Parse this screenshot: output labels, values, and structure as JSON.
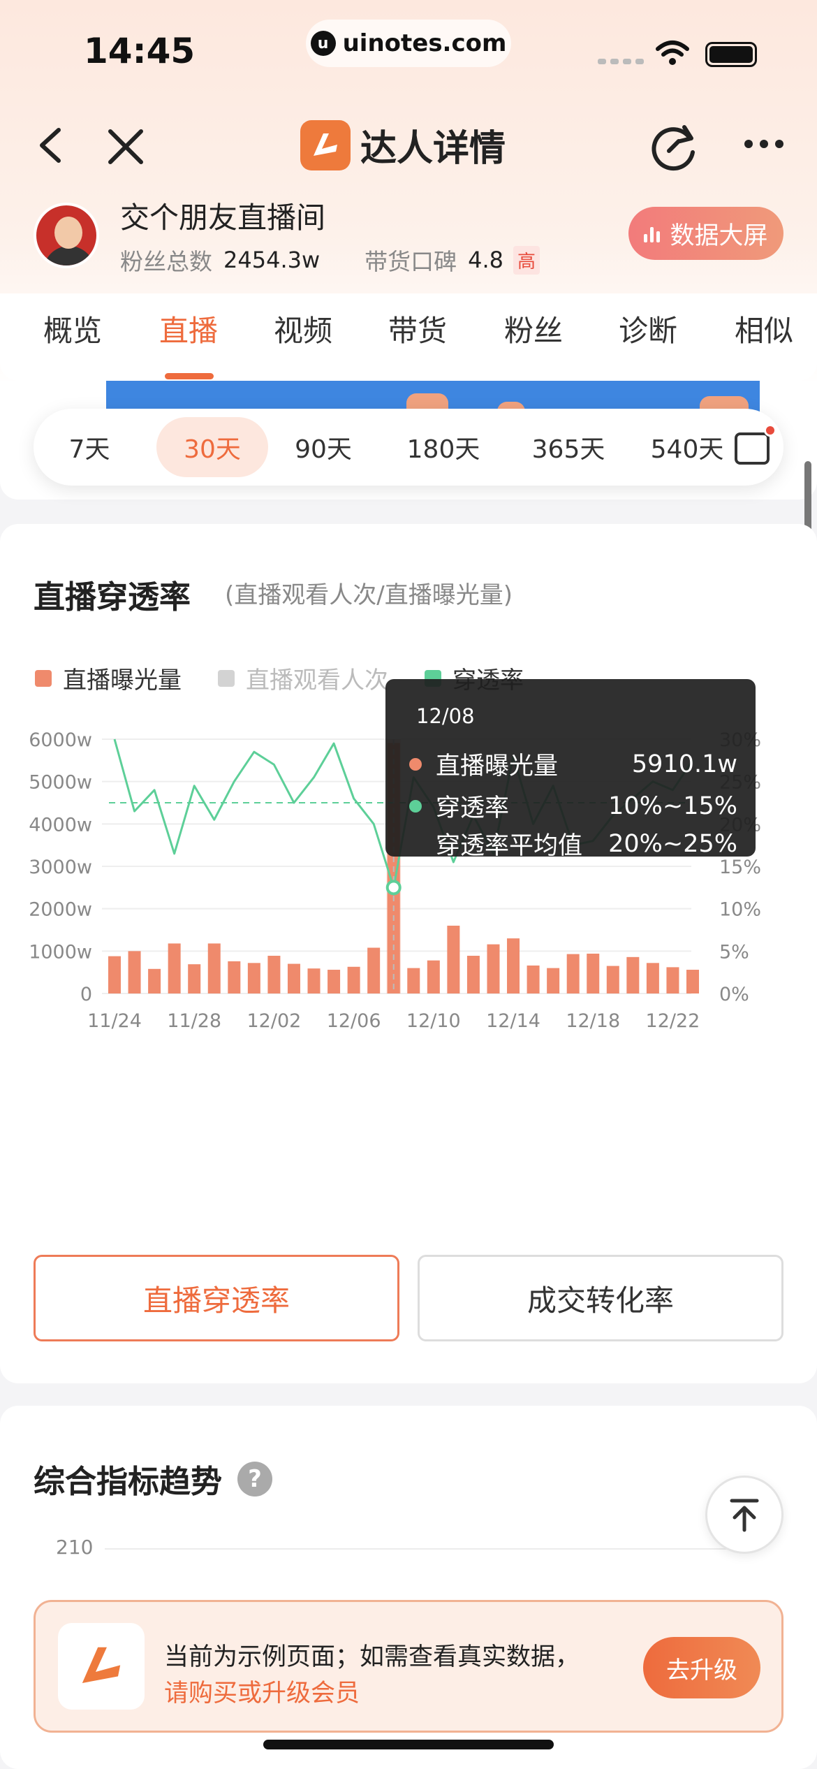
{
  "status_bar": {
    "time": "14:45",
    "url": "uinotes.com"
  },
  "nav": {
    "title": "达人详情"
  },
  "profile": {
    "name": "交个朋友直播间",
    "fans_label": "粉丝总数",
    "fans_value": "2454.3w",
    "reputation_label": "带货口碑",
    "reputation_value": "4.8",
    "reputation_tag": "高",
    "big_screen_label": "数据大屏"
  },
  "tabs": [
    "概览",
    "直播",
    "视频",
    "带货",
    "粉丝",
    "诊断",
    "相似"
  ],
  "active_tab": "直播",
  "day_ranges": [
    "7天",
    "30天",
    "90天",
    "180天",
    "365天",
    "540天"
  ],
  "active_range": "30天",
  "penetration": {
    "title": "直播穿透率",
    "subtitle": "(直播观看人次/直播曝光量)",
    "legend": [
      {
        "name": "直播曝光量",
        "color": "#ef8a6c"
      },
      {
        "name": "直播观看人次",
        "color": "#d3d3d3"
      },
      {
        "name": "穿透率",
        "color": "#5dcf98"
      }
    ],
    "tooltip": {
      "date": "12/08",
      "rows": [
        {
          "label": "直播曝光量",
          "value": "5910.1w"
        },
        {
          "label": "穿透率",
          "value": "10%~15%"
        },
        {
          "label": "穿透率平均值",
          "value": "20%~25%"
        }
      ]
    },
    "buttons": [
      "直播穿透率",
      "成交转化率"
    ]
  },
  "chart_data": {
    "type": "bar",
    "x_ticks": [
      "11/24",
      "11/28",
      "12/02",
      "12/06",
      "12/10",
      "12/14",
      "12/18",
      "12/22"
    ],
    "y_left_ticks": [
      "0",
      "1000w",
      "2000w",
      "3000w",
      "4000w",
      "5000w",
      "6000w"
    ],
    "y_right_ticks": [
      "0%",
      "5%",
      "10%",
      "15%",
      "20%",
      "25%",
      "30%"
    ],
    "ylim_left": [
      0,
      6000
    ],
    "ylim_right": [
      0,
      30
    ],
    "x": [
      "11/24",
      "11/25",
      "11/26",
      "11/27",
      "11/28",
      "11/29",
      "11/30",
      "12/01",
      "12/02",
      "12/03",
      "12/04",
      "12/05",
      "12/06",
      "12/07",
      "12/08",
      "12/09",
      "12/10",
      "12/11",
      "12/12",
      "12/13",
      "12/14",
      "12/15",
      "12/16",
      "12/17",
      "12/18",
      "12/19",
      "12/20",
      "12/21",
      "12/22",
      "12/23"
    ],
    "series": [
      {
        "name": "直播曝光量",
        "axis": "left",
        "values": [
          880,
          1000,
          580,
          1180,
          690,
          1180,
          760,
          720,
          890,
          700,
          590,
          560,
          630,
          1080,
          5910,
          600,
          780,
          1600,
          890,
          1160,
          1300,
          660,
          600,
          930,
          940,
          650,
          860,
          720,
          620,
          560
        ]
      },
      {
        "name": "穿透率",
        "axis": "right",
        "values": [
          30,
          21.5,
          24,
          16.5,
          24.5,
          20.5,
          25,
          28.5,
          27,
          22.5,
          25.5,
          29.5,
          23,
          20,
          12.5,
          25.5,
          22,
          15.5,
          21,
          16.5,
          28,
          20,
          24.5,
          17.5,
          18,
          21,
          23,
          25,
          24,
          27.5
        ]
      },
      {
        "name": "穿透率平均值",
        "axis": "right",
        "style": "dashed",
        "values": [
          22.5
        ]
      }
    ],
    "highlight": "12/08"
  },
  "trend": {
    "title": "综合指标趋势",
    "y_first_tick": "210"
  },
  "banner": {
    "line1": "当前为示例页面；如需查看真实数据，",
    "line2": "请购买或升级会员",
    "button": "去升级"
  }
}
